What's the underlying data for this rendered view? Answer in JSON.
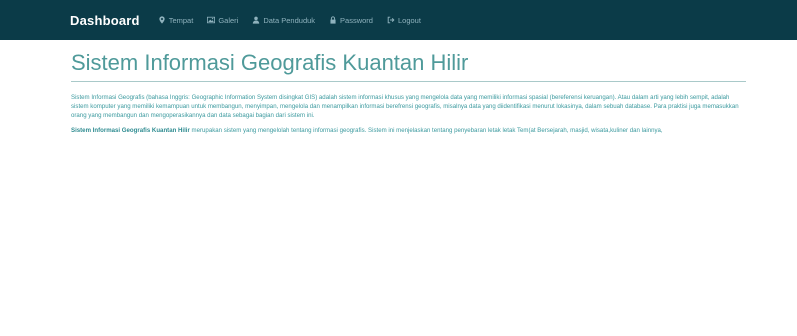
{
  "navbar": {
    "brand": "Dashboard",
    "items": [
      {
        "label": "Tempat",
        "icon": "map-marker-icon"
      },
      {
        "label": "Galeri",
        "icon": "picture-icon"
      },
      {
        "label": "Data Penduduk",
        "icon": "user-icon"
      },
      {
        "label": "Password",
        "icon": "lock-icon"
      },
      {
        "label": "Logout",
        "icon": "logout-icon"
      }
    ],
    "background": "#0b3b48"
  },
  "main": {
    "title": "Sistem Informasi Geografis Kuantan Hilir",
    "paragraph1": "Sistem Informasi Geografis (bahasa Inggris: Geographic Information System disingkat GIS) adalah sistem informasi khusus yang mengelola data yang memiliki informasi spasial (bereferensi keruangan). Atau dalam arti yang lebih sempit, adalah sistem komputer yang memiliki kemampuan untuk membangun, menyimpan, mengelola dan menampilkan informasi berefrensi geografis, misalnya data yang diidentifikasi menurut lokasinya, dalam sebuah database. Para praktisi juga memasukkan orang yang membangun dan mengoperasikannya dan data sebagai bagian dari sistem ini.",
    "paragraph2_bold": "Sistem Informasi Geografis Kuantan Hilir",
    "paragraph2_rest": " merupakan sistem yang mengelolah tentang informasi geografis. Sistem ini menjelaskan tentang penyebaran letak letak Tem(at Bersejarah, masjid, wisata,kuliner dan lainnya,",
    "accent_color": "#4f9a9a"
  }
}
